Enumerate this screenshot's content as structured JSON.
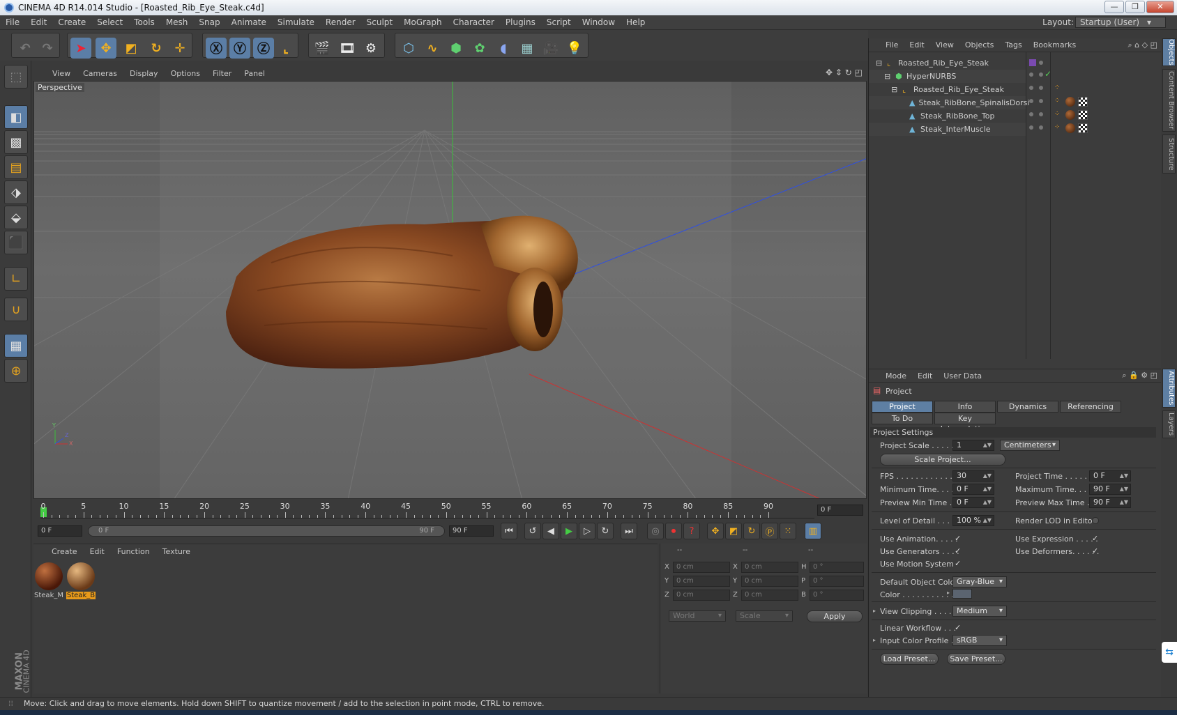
{
  "window": {
    "title": "CINEMA 4D R14.014 Studio - [Roasted_Rib_Eye_Steak.c4d]"
  },
  "menubar": {
    "items": [
      "File",
      "Edit",
      "Create",
      "Select",
      "Tools",
      "Mesh",
      "Snap",
      "Animate",
      "Simulate",
      "Render",
      "Sculpt",
      "MoGraph",
      "Character",
      "Plugins",
      "Script",
      "Window",
      "Help"
    ],
    "layout_label": "Layout:",
    "layout_value": "Startup (User)"
  },
  "viewport": {
    "menu": [
      "View",
      "Cameras",
      "Display",
      "Options",
      "Filter",
      "Panel"
    ],
    "label": "Perspective"
  },
  "timeline": {
    "ticks": [
      "0",
      "5",
      "10",
      "15",
      "20",
      "25",
      "30",
      "35",
      "40",
      "45",
      "50",
      "55",
      "60",
      "65",
      "70",
      "75",
      "80",
      "85",
      "90"
    ],
    "current_frame": "0 F",
    "start_field": "0 F",
    "range_start": "0 F",
    "range_end": "90 F",
    "end_field": "90 F"
  },
  "materials": {
    "menu": [
      "Create",
      "Edit",
      "Function",
      "Texture"
    ],
    "items": [
      {
        "name": "Steak_M",
        "selected": false
      },
      {
        "name": "Steak_B",
        "selected": true
      }
    ]
  },
  "coordinates": {
    "headers": [
      "--",
      "--",
      "--"
    ],
    "rows": [
      {
        "l1": "X",
        "v1": "0 cm",
        "l2": "X",
        "v2": "0 cm",
        "l3": "H",
        "v3": "0 °"
      },
      {
        "l1": "Y",
        "v1": "0 cm",
        "l2": "Y",
        "v2": "0 cm",
        "l3": "P",
        "v3": "0 °"
      },
      {
        "l1": "Z",
        "v1": "0 cm",
        "l2": "Z",
        "v2": "0 cm",
        "l3": "B",
        "v3": "0 °"
      }
    ],
    "mode_select": "World",
    "scale_select": "Scale",
    "apply_label": "Apply"
  },
  "object_manager": {
    "menu": [
      "File",
      "Edit",
      "View",
      "Objects",
      "Tags",
      "Bookmarks"
    ],
    "objects": [
      {
        "name": "Roasted_Rib_Eye_Steak",
        "indent": 0
      },
      {
        "name": "HyperNURBS",
        "indent": 1
      },
      {
        "name": "Roasted_Rib_Eye_Steak",
        "indent": 2
      },
      {
        "name": "Steak_RibBone_SpinalisDorsi",
        "indent": 3
      },
      {
        "name": "Steak_RibBone_Top",
        "indent": 3
      },
      {
        "name": "Steak_InterMuscle",
        "indent": 3
      }
    ]
  },
  "attributes": {
    "menu": [
      "Mode",
      "Edit",
      "User Data"
    ],
    "object_label": "Project",
    "tabs_row1": [
      "Project Settings",
      "Info",
      "Dynamics",
      "Referencing"
    ],
    "tabs_row2": [
      "To Do",
      "Key Interpolation"
    ],
    "section_title": "Project Settings",
    "project_scale_label": "Project Scale . . . . . .",
    "project_scale_value": "1",
    "project_scale_unit": "Centimeters",
    "scale_project_button": "Scale Project...",
    "fps_label": "FPS . . . . . . . . . . . . . .",
    "fps_value": "30",
    "project_time_label": "Project Time . . . . . . .",
    "project_time_value": "0 F",
    "min_time_label": "Minimum Time. . . . .",
    "min_time_value": "0 F",
    "max_time_label": "Maximum Time. . . . . .",
    "max_time_value": "90 F",
    "prev_min_label": "Preview Min Time . .",
    "prev_min_value": "0 F",
    "prev_max_label": "Preview Max Time . . .",
    "prev_max_value": "90 F",
    "lod_label": "Level of Detail . . . . .",
    "lod_value": "100 %",
    "render_lod_label": "Render LOD in Editor",
    "use_animation_label": "Use Animation. . . . .",
    "use_expression_label": "Use Expression . . . . .",
    "use_generators_label": "Use Generators . . . .",
    "use_deformers_label": "Use Deformers. . . . . .",
    "use_motion_label": "Use Motion System",
    "default_color_label": "Default Object Color",
    "default_color_value": "Gray-Blue",
    "color_label": "Color . . . . . . . . . . .",
    "view_clipping_label": "View Clipping . . . . .",
    "view_clipping_value": "Medium",
    "linear_workflow_label": "Linear Workflow . . .",
    "input_color_label": "Input Color Profile .",
    "input_color_value": "sRGB",
    "load_preset": "Load Preset...",
    "save_preset": "Save Preset...",
    "check_mark": "✓"
  },
  "side_tabs": [
    "Objects",
    "Content Browser",
    "Structure",
    "Attributes",
    "Layers"
  ],
  "status": "Move: Click and drag to move elements. Hold down SHIFT to quantize movement / add to the selection in point mode, CTRL to remove.",
  "branding": {
    "maxon": "MAXON",
    "c4d": "CINEMA 4D"
  },
  "colors": {
    "accent": "#5e7fa3",
    "steak": "#8a4a22",
    "bg": "#3c3c3c"
  }
}
